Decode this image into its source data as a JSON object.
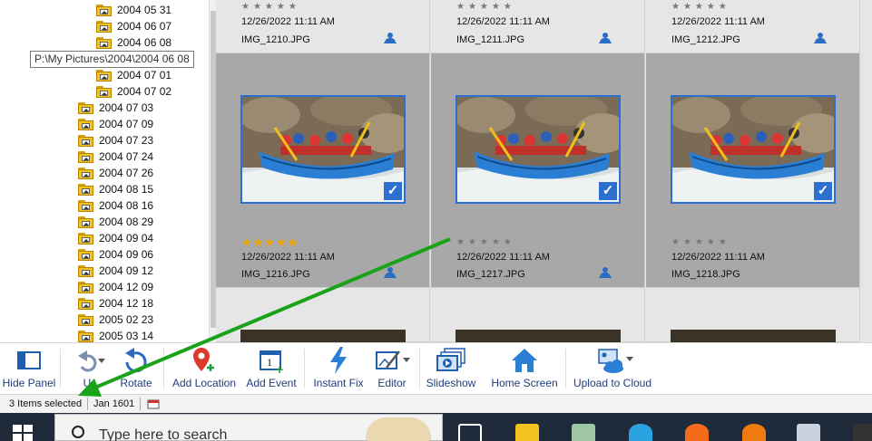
{
  "folder_tree": {
    "items": [
      {
        "label": "2004 05 31",
        "indent": 1
      },
      {
        "label": "2004 06 07",
        "indent": 1
      },
      {
        "label": "2004 06 08",
        "indent": 1
      },
      {
        "label": "2004 07 01",
        "indent": 1
      },
      {
        "label": "2004 07 02",
        "indent": 1
      },
      {
        "label": "2004 07 03",
        "indent": 0
      },
      {
        "label": "2004 07 09",
        "indent": 0
      },
      {
        "label": "2004 07 23",
        "indent": 0
      },
      {
        "label": "2004 07 24",
        "indent": 0
      },
      {
        "label": "2004 07 26",
        "indent": 0
      },
      {
        "label": "2004 08 15",
        "indent": 0
      },
      {
        "label": "2004 08 16",
        "indent": 0
      },
      {
        "label": "2004 08 29",
        "indent": 0
      },
      {
        "label": "2004 09 04",
        "indent": 0
      },
      {
        "label": "2004 09 06",
        "indent": 0
      },
      {
        "label": "2004 09 12",
        "indent": 0
      },
      {
        "label": "2004 12 09",
        "indent": 0
      },
      {
        "label": "2004 12 18",
        "indent": 0
      },
      {
        "label": "2005 02 23",
        "indent": 0
      },
      {
        "label": "2005 03 14",
        "indent": 0
      }
    ],
    "tooltip": "P:\\My Pictures\\2004\\2004 06 08"
  },
  "photos_top": [
    {
      "date": "12/26/2022 11:11 AM",
      "name": "IMG_1210.JPG",
      "stars": "★★★★★"
    },
    {
      "date": "12/26/2022 11:11 AM",
      "name": "IMG_1211.JPG",
      "stars": "★★★★★"
    },
    {
      "date": "12/26/2022 11:11 AM",
      "name": "IMG_1212.JPG",
      "stars": "★★★★★"
    }
  ],
  "photos_selected": [
    {
      "date": "12/26/2022 11:11 AM",
      "name": "IMG_1216.JPG",
      "stars": "★★★★★",
      "rating": 5,
      "checked": "✓"
    },
    {
      "date": "12/26/2022 11:11 AM",
      "name": "IMG_1217.JPG",
      "stars": "★★★★★",
      "rating": 0,
      "checked": "✓"
    },
    {
      "date": "12/26/2022 11:11 AM",
      "name": "IMG_1218.JPG",
      "stars": "★★★★★",
      "rating": 0,
      "checked": "✓"
    }
  ],
  "toolbar": {
    "hide_panel": "Hide Panel",
    "undo": "U",
    "rotate": "Rotate",
    "add_location": "Add Location",
    "add_event": "Add Event",
    "event_day": "1",
    "instant_fix": "Instant Fix",
    "editor": "Editor",
    "slideshow": "Slideshow",
    "home_screen": "Home Screen",
    "upload_cloud": "Upload to Cloud"
  },
  "status": {
    "selected": "3 Items selected",
    "date": "Jan 1601"
  },
  "taskbar": {
    "search_placeholder": "Type here to search"
  },
  "colors": {
    "accent": "#2c6fd0",
    "selected_cell": "#a8a8a8",
    "arrow": "#1aa31a",
    "star_gold": "#f0a500"
  }
}
